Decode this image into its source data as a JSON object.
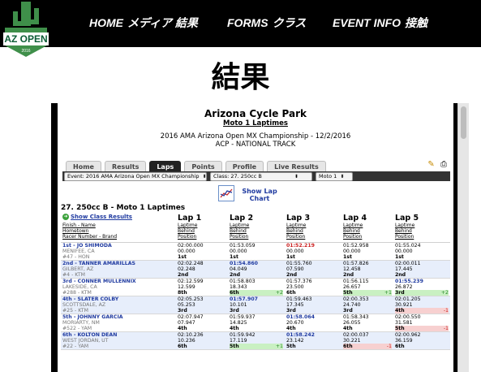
{
  "logo": {
    "text": "AZ OPEN",
    "sub": "2016"
  },
  "nav": [
    {
      "en": "HOME",
      "jp": "メディア 結果"
    },
    {
      "en": "FORMS",
      "jp": "クラス"
    },
    {
      "en": "EVENT INFO",
      "jp": "接触"
    }
  ],
  "heading": "結果",
  "report": {
    "park": "Arizona Cycle Park",
    "moto": "Moto 1 Laptimes",
    "championship": "2016 AMA Arizona Open MX Championship - 12/2/2016",
    "track": "ACP - NATIONAL TRACK"
  },
  "tabs": [
    "Home",
    "Results",
    "Laps",
    "Points",
    "Profile",
    "Live Results"
  ],
  "active_tab": "Laps",
  "selects": {
    "event": "Event: 2016 AMA Arizona Open MX Championship",
    "class": "Class: 27. 250cc B",
    "moto": "Moto 1"
  },
  "lap_chart_label": "Show Lap Chart",
  "class_title": "27. 250cc B - Moto 1 Laptimes",
  "show_class_results": "Show Class Results",
  "lap_headers": [
    "Lap 1",
    "Lap 2",
    "Lap 3",
    "Lap 4",
    "Lap 5"
  ],
  "col_rider_sub": [
    "Finish - Name",
    "Hometown",
    "Racer Number - Brand"
  ],
  "col_lap_sub": [
    "Laptime",
    "Behind",
    "Position"
  ],
  "riders": [
    {
      "name": "1st - JO SHIMODA",
      "home": "MENIFEE, CA",
      "num": "#47 - HON",
      "laps": [
        {
          "t": "02:00.000",
          "b": "00.000",
          "p": "1st",
          "style": "",
          "pstyle": "",
          "d": ""
        },
        {
          "t": "01:53.059",
          "b": "00.000",
          "p": "1st",
          "style": "",
          "pstyle": "",
          "d": ""
        },
        {
          "t": "01:52.219",
          "b": "00.000",
          "p": "1st",
          "style": "slow",
          "pstyle": "",
          "d": ""
        },
        {
          "t": "01:52.958",
          "b": "00.000",
          "p": "1st",
          "style": "",
          "pstyle": "",
          "d": ""
        },
        {
          "t": "01:55.024",
          "b": "00.000",
          "p": "1st",
          "style": "",
          "pstyle": "",
          "d": ""
        }
      ]
    },
    {
      "name": "2nd - TANNER AMARILLAS",
      "home": "GILBERT, AZ",
      "num": "#4 - KTM",
      "laps": [
        {
          "t": "02:02.248",
          "b": "02.248",
          "p": "2nd",
          "style": "",
          "pstyle": "",
          "d": ""
        },
        {
          "t": "01:54.860",
          "b": "04.049",
          "p": "2nd",
          "style": "best",
          "pstyle": "",
          "d": ""
        },
        {
          "t": "01:55.760",
          "b": "07.590",
          "p": "2nd",
          "style": "",
          "pstyle": "",
          "d": ""
        },
        {
          "t": "01:57.826",
          "b": "12.458",
          "p": "2nd",
          "style": "",
          "pstyle": "",
          "d": ""
        },
        {
          "t": "02:00.011",
          "b": "17.445",
          "p": "2nd",
          "style": "",
          "pstyle": "",
          "d": ""
        }
      ]
    },
    {
      "name": "3rd - CONNER MULLENNIX",
      "home": "LAKESIDE, CA",
      "num": "#288 - KTM",
      "laps": [
        {
          "t": "02:12.599",
          "b": "12.599",
          "p": "8th",
          "style": "",
          "pstyle": "",
          "d": ""
        },
        {
          "t": "01:58.803",
          "b": "18.343",
          "p": "6th",
          "style": "",
          "pstyle": "green",
          "d": "+2"
        },
        {
          "t": "01:57.376",
          "b": "23.500",
          "p": "6th",
          "style": "",
          "pstyle": "",
          "d": ""
        },
        {
          "t": "01:56.115",
          "b": "26.657",
          "p": "5th",
          "style": "",
          "pstyle": "green",
          "d": "+1"
        },
        {
          "t": "01:55.239",
          "b": "26.872",
          "p": "3rd",
          "style": "best",
          "pstyle": "green",
          "d": "+2"
        }
      ]
    },
    {
      "name": "4th - SLATER COLBY",
      "home": "SCOTTSDALE, AZ",
      "num": "#25 - KTM",
      "laps": [
        {
          "t": "02:05.253",
          "b": "05.253",
          "p": "3rd",
          "style": "",
          "pstyle": "",
          "d": ""
        },
        {
          "t": "01:57.907",
          "b": "10.101",
          "p": "3rd",
          "style": "best",
          "pstyle": "",
          "d": ""
        },
        {
          "t": "01:59.463",
          "b": "17.345",
          "p": "3rd",
          "style": "",
          "pstyle": "",
          "d": ""
        },
        {
          "t": "02:00.353",
          "b": "24.740",
          "p": "3rd",
          "style": "",
          "pstyle": "",
          "d": ""
        },
        {
          "t": "02:01.205",
          "b": "30.921",
          "p": "4th",
          "style": "",
          "pstyle": "red",
          "d": "-1"
        }
      ]
    },
    {
      "name": "5th - JOHNNY GARCIA",
      "home": "MORIARTY, NM",
      "num": "#522 - YAM",
      "laps": [
        {
          "t": "02:07.947",
          "b": "07.947",
          "p": "4th",
          "style": "",
          "pstyle": "",
          "d": ""
        },
        {
          "t": "01:59.937",
          "b": "14.825",
          "p": "4th",
          "style": "",
          "pstyle": "",
          "d": ""
        },
        {
          "t": "01:58.064",
          "b": "20.670",
          "p": "4th",
          "style": "best",
          "pstyle": "",
          "d": ""
        },
        {
          "t": "01:58.343",
          "b": "26.055",
          "p": "4th",
          "style": "",
          "pstyle": "",
          "d": ""
        },
        {
          "t": "02:00.550",
          "b": "31.581",
          "p": "5th",
          "style": "",
          "pstyle": "red",
          "d": "-1"
        }
      ]
    },
    {
      "name": "6th - KOLTON DEAN",
      "home": "WEST JORDAN, UT",
      "num": "#22 - YAM",
      "laps": [
        {
          "t": "02:10.236",
          "b": "10.236",
          "p": "6th",
          "style": "",
          "pstyle": "",
          "d": ""
        },
        {
          "t": "01:59.942",
          "b": "17.119",
          "p": "5th",
          "style": "",
          "pstyle": "green",
          "d": "+1"
        },
        {
          "t": "01:58.242",
          "b": "23.142",
          "p": "5th",
          "style": "best",
          "pstyle": "",
          "d": ""
        },
        {
          "t": "02:00.037",
          "b": "30.221",
          "p": "6th",
          "style": "",
          "pstyle": "red",
          "d": "-1"
        },
        {
          "t": "02:00.962",
          "b": "36.159",
          "p": "6th",
          "style": "",
          "pstyle": "",
          "d": ""
        }
      ]
    }
  ]
}
